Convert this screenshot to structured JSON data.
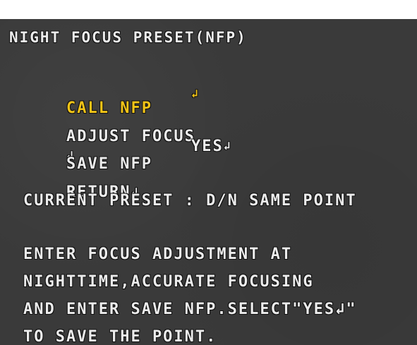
{
  "osd": {
    "title": "NIGHT FOCUS PRESET(NFP)",
    "enter_glyph": "↲",
    "menu": [
      {
        "label": "CALL NFP",
        "value": "",
        "selected": true
      },
      {
        "label": "ADJUST FOCUS",
        "value": ""
      },
      {
        "label": "SAVE NFP",
        "value": "YES"
      },
      {
        "label": "RETURN",
        "value": ""
      }
    ],
    "current_preset": "CURRENT PRESET : D/N SAME POINT",
    "help": [
      "ENTER FOCUS ADJUSTMENT AT",
      "NIGHTTIME,ACCURATE FOCUSING",
      "AND ENTER SAVE NFP.SELECT\"YES↲\"",
      "TO SAVE THE POINT."
    ],
    "colors": {
      "background": "#3a3a3a",
      "text": "#ececec",
      "selected": "#f2c417"
    }
  }
}
